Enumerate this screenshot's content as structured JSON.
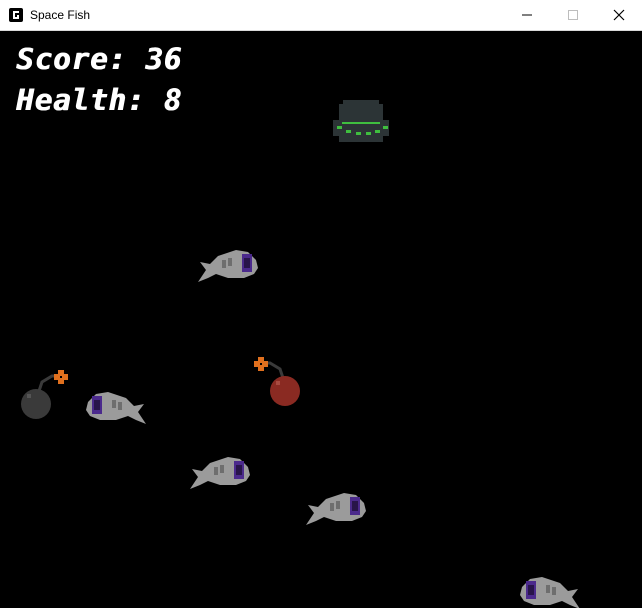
{
  "window": {
    "title": "Space Fish"
  },
  "hud": {
    "score_text": "Score: 36",
    "health_text": "Health: 8"
  },
  "colors": {
    "background": "#000000",
    "fish": "#9b9b9b",
    "fish_eye": "#4b2a8c",
    "ufo": "#2c3436",
    "ufo_lights": "#3fbf3f",
    "bomb_gray": "#3a3a3a",
    "bomb_red": "#8a2a22",
    "fuse_spark": "#e0701e"
  },
  "sprites": [
    {
      "kind": "ufo",
      "icon": "ufo-icon"
    },
    {
      "kind": "fish",
      "icon": "space-fish-icon"
    },
    {
      "kind": "bomb",
      "icon": "bomb-icon"
    }
  ]
}
